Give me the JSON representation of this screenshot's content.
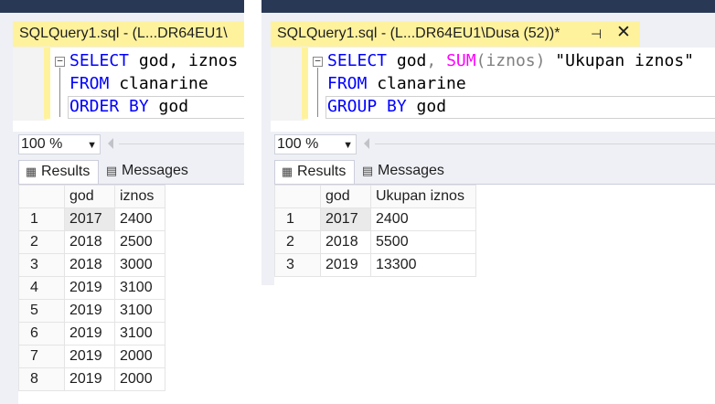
{
  "left": {
    "tab_title": "SQLQuery1.sql - (L...DR64EU1\\",
    "code": {
      "line1": {
        "kw": "SELECT",
        "rest": " god, iznos"
      },
      "line2": {
        "kw": "FROM",
        "rest": " clanarine"
      },
      "line3": {
        "kw1": "ORDER",
        "kw2": "BY",
        "rest": " god"
      }
    },
    "zoom": "100 %",
    "results_tab": "Results",
    "messages_tab": "Messages",
    "columns": [
      "god",
      "iznos"
    ],
    "rows": [
      {
        "n": "1",
        "god": "2017",
        "val": "2400"
      },
      {
        "n": "2",
        "god": "2018",
        "val": "2500"
      },
      {
        "n": "3",
        "god": "2018",
        "val": "3000"
      },
      {
        "n": "4",
        "god": "2019",
        "val": "3100"
      },
      {
        "n": "5",
        "god": "2019",
        "val": "3100"
      },
      {
        "n": "6",
        "god": "2019",
        "val": "3100"
      },
      {
        "n": "7",
        "god": "2019",
        "val": "2000"
      },
      {
        "n": "8",
        "god": "2019",
        "val": "2000"
      }
    ]
  },
  "right": {
    "tab_title": "SQLQuery1.sql - (L...DR64EU1\\Dusa (52))*",
    "pin_glyph": "⊣",
    "close_glyph": "✕",
    "code": {
      "line1": {
        "kw": "SELECT",
        "mid": " god",
        "comma": ",",
        "fn": "SUM",
        "args": "(iznos)",
        "str": "\"Ukupan iznos\""
      },
      "line2": {
        "kw": "FROM",
        "rest": " clanarine"
      },
      "line3": {
        "kw1": "GROUP",
        "kw2": "BY",
        "rest": " god"
      }
    },
    "zoom": "100 %",
    "results_tab": "Results",
    "messages_tab": "Messages",
    "columns": [
      "god",
      "Ukupan iznos"
    ],
    "rows": [
      {
        "n": "1",
        "god": "2017",
        "val": "2400"
      },
      {
        "n": "2",
        "god": "2018",
        "val": "5500"
      },
      {
        "n": "3",
        "god": "2019",
        "val": "13300"
      }
    ]
  },
  "icons": {
    "results": "grid-icon",
    "messages": "messages-icon",
    "collapse": "collapse-minus-icon",
    "dropdown": "chevron-down-icon",
    "scroll": "scroll-left-arrow-icon"
  },
  "colors": {
    "title_navy": "#293955",
    "active_tab_yellow": "#fff29d",
    "keyword_blue": "#0000ff",
    "function_magenta": "#ff00ff",
    "string_red": "#a31515"
  }
}
